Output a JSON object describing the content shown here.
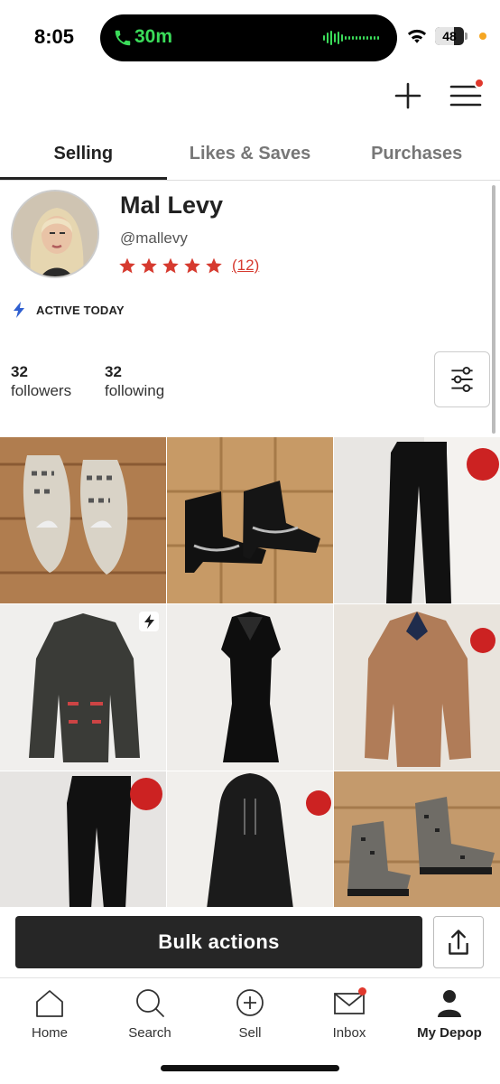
{
  "status_bar": {
    "time": "8:05",
    "call_duration": "30m",
    "battery": "48",
    "call_color": "#3bdc5a"
  },
  "header": {
    "add_icon": "plus-icon",
    "menu_icon": "hamburger-icon"
  },
  "tabs": [
    {
      "label": "Selling",
      "active": true
    },
    {
      "label": "Likes & Saves",
      "active": false
    },
    {
      "label": "Purchases",
      "active": false
    }
  ],
  "profile": {
    "name": "Mal Levy",
    "handle": "@mallevy",
    "stars": 5,
    "reviews": "(12)",
    "activity": "ACTIVE TODAY",
    "followers_count": "32",
    "followers_label": "followers",
    "following_count": "32",
    "following_label": "following"
  },
  "listings": [
    {
      "item": "snakeskin mules",
      "boosted": false
    },
    {
      "item": "black ankle boots",
      "boosted": false
    },
    {
      "item": "black pants",
      "boosted": false
    },
    {
      "item": "leather moto jacket",
      "boosted": true
    },
    {
      "item": "black mesh dress",
      "boosted": false
    },
    {
      "item": "tan button shirt",
      "boosted": false
    },
    {
      "item": "black paperbag pants",
      "boosted": false
    },
    {
      "item": "black hooded dress",
      "boosted": false
    },
    {
      "item": "leopard rain boots",
      "boosted": false
    }
  ],
  "actions": {
    "bulk_label": "Bulk actions",
    "share_icon": "share-icon"
  },
  "bottom_nav": [
    {
      "label": "Home",
      "icon": "home-icon"
    },
    {
      "label": "Search",
      "icon": "search-icon"
    },
    {
      "label": "Sell",
      "icon": "plus-circle-icon"
    },
    {
      "label": "Inbox",
      "icon": "mail-icon"
    },
    {
      "label": "My Depop",
      "icon": "person-icon"
    }
  ],
  "colors": {
    "accent_red": "#d63a2f",
    "button_dark": "#262626"
  }
}
